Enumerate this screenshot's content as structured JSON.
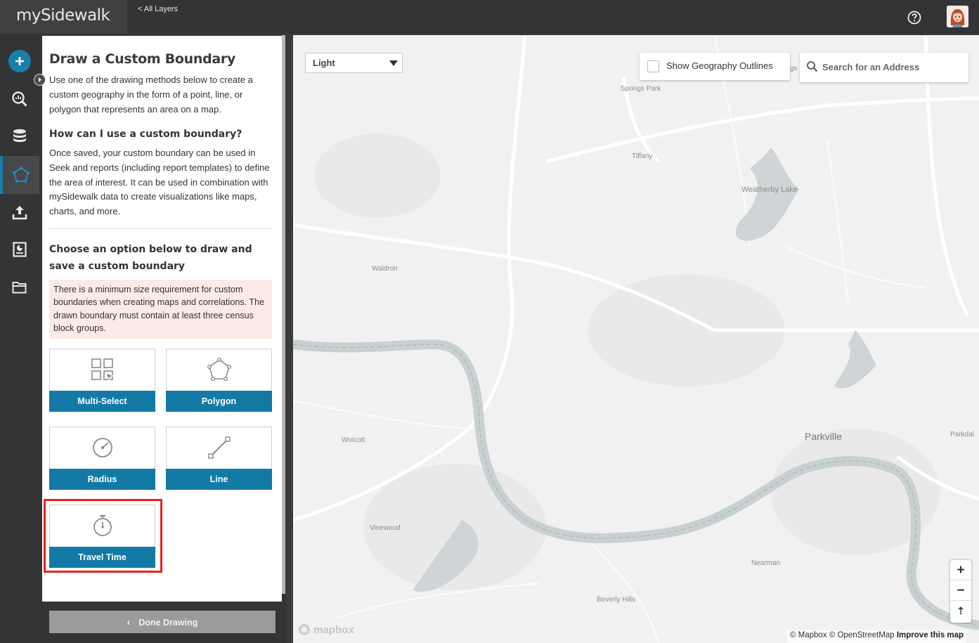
{
  "app": {
    "logo": "mySidewalk",
    "back_link": "< All Layers"
  },
  "rail": {
    "items": [
      "add-layer",
      "seek",
      "data",
      "custom-boundary",
      "upload",
      "reports",
      "projects"
    ]
  },
  "panel": {
    "title": "Draw a Custom Boundary",
    "intro": "Use one of the drawing methods below to create a custom geography in the form of a point, line, or polygon that represents an area on a map.",
    "how_heading": "How can I use a custom boundary?",
    "how_body": "Once saved, your custom boundary can be used in Seek and reports (including report templates) to define the area of interest. It can be used in combination with mySidewalk data to create visualizations like maps, charts, and more.",
    "choose_heading": "Choose an option below to draw and save a custom boundary",
    "warning": "There is a minimum size requirement for custom boundaries when creating maps and correlations. The drawn boundary must contain at least three census block groups.",
    "tools": {
      "multiselect": "Multi-Select",
      "polygon": "Polygon",
      "radius": "Radius",
      "line": "Line",
      "travel_time": "Travel Time"
    },
    "done_button": "Done Drawing"
  },
  "map": {
    "basemap_selected": "Light",
    "geo_outlines_label": "Show Geography Outlines",
    "search_placeholder": "Search for an Address",
    "zoom_in": "+",
    "zoom_out": "−",
    "compass": "⇡",
    "labels": {
      "tiffany": "Tiffany",
      "springs": "Springs Park",
      "weatherby": "Weatherby Lake",
      "waldron": "Waldron",
      "wolcott": "Wolcott",
      "parkville": "Parkville",
      "parkdal": "Parkdal",
      "vinewood": "Vinewood",
      "nearman": "Nearman",
      "beverly": "Beverly Hills",
      "ags": "gs"
    },
    "mapbox_logo": "mapbox",
    "attribution_mapbox": "© Mapbox",
    "attribution_osm": "© OpenStreetMap",
    "attribution_improve": "Improve this map"
  },
  "colors": {
    "accent": "#137aa6",
    "highlight": "#e8221b",
    "warning_bg": "#fbeae6"
  }
}
